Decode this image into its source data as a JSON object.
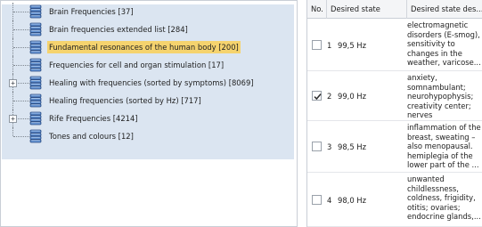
{
  "tree": {
    "items": [
      {
        "label": "Brain Frequencies [37]",
        "expandable": false
      },
      {
        "label": "Brain frequencies extended list [284]",
        "expandable": false
      },
      {
        "label": "Fundamental resonances of the human body [200]",
        "expandable": false,
        "selected": true
      },
      {
        "label": "Frequencies for cell and organ stimulation [17]",
        "expandable": false
      },
      {
        "label": "Healing with frequencies (sorted by symptoms) [8069]",
        "expandable": true
      },
      {
        "label": "Healing frequencies (sorted by Hz) [717]",
        "expandable": false
      },
      {
        "label": "Rife Frequencies [4214]",
        "expandable": true
      },
      {
        "label": "Tones and colours [12]",
        "expandable": false
      }
    ],
    "expander_glyph": "+",
    "icon": "database-icon"
  },
  "grid": {
    "headers": {
      "no": "No.",
      "state": "Desired state",
      "desc": "Desired state des..."
    },
    "rows": [
      {
        "no": "1",
        "state": "99,5 Hz",
        "checked": false,
        "desc": "electromagnetic disorders (E-smog), sensitivity to changes in the weather, varicose..."
      },
      {
        "no": "2",
        "state": "99,0 Hz",
        "checked": true,
        "desc": "anxiety, somnambulant; neurohypophysis; creativity center; nerves"
      },
      {
        "no": "3",
        "state": "98,5 Hz",
        "checked": false,
        "desc": "inflammation of the breast, sweating – also menopausal. hemiplegia of the lower part of the ..."
      },
      {
        "no": "4",
        "state": "98,0 Hz",
        "checked": false,
        "desc": "unwanted childlessness, coldness, frigidity, otitis; ovaries; endocrine glands,..."
      }
    ]
  },
  "colors": {
    "selection_band": "#dbe5f1",
    "selected_label": "#f5d36e",
    "db_icon_dark": "#2d4f86",
    "db_icon_light": "#5f8fd0"
  }
}
